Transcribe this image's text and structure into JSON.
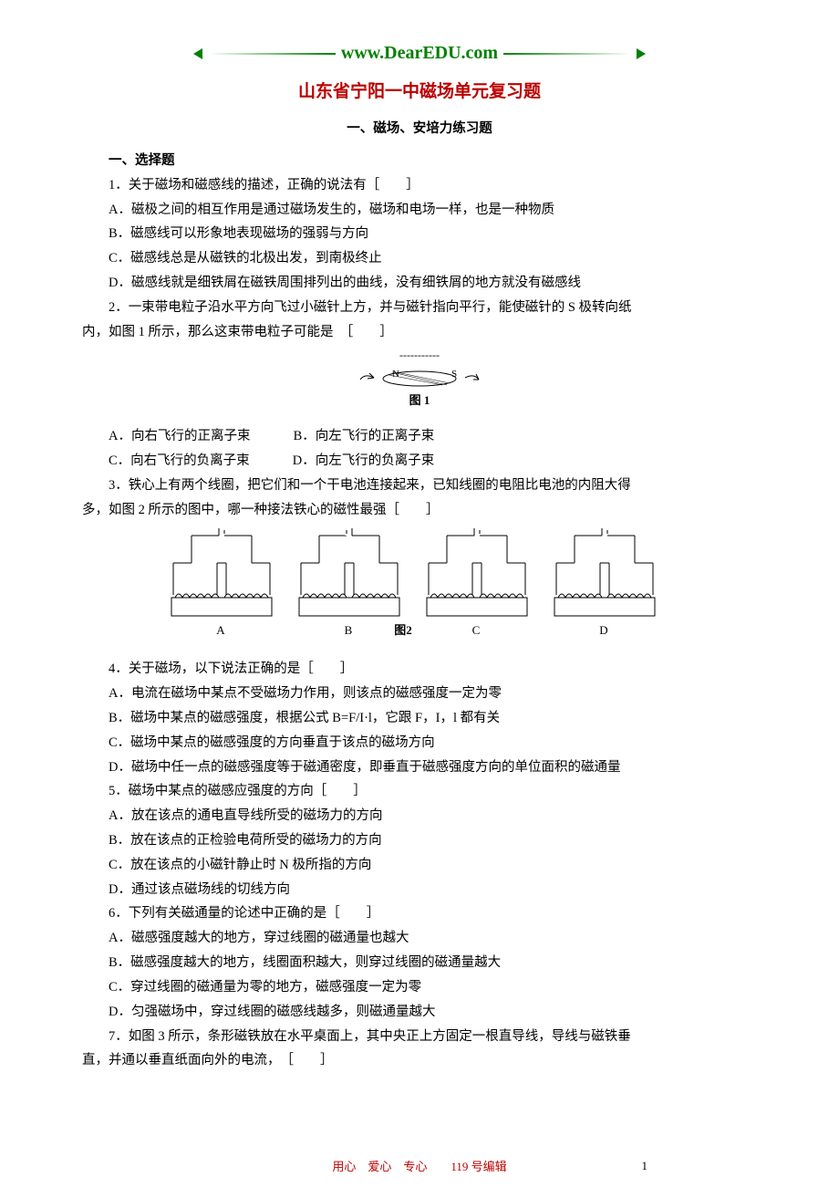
{
  "logo": {
    "url": "www.DearEDU.com"
  },
  "title": "山东省宁阳一中磁场单元复习题",
  "subtitle": "一、磁场、安培力练习题",
  "section1": "一、选择题",
  "q1": {
    "stem": "1．关于磁场和磁感线的描述，正确的说法有［　　］",
    "a": "A．磁极之间的相互作用是通过磁场发生的，磁场和电场一样，也是一种物质",
    "b": "B．磁感线可以形象地表现磁场的强弱与方向",
    "c": "C．磁感线总是从磁铁的北极出发，到南极终止",
    "d": "D．磁感线就是细铁屑在磁铁周围排列出的曲线，没有细铁屑的地方就没有磁感线"
  },
  "q2": {
    "stem_a": "2．一束带电粒子沿水平方向飞过小磁针上方，并与磁针指向平行，能使磁针的 S 极转向纸",
    "stem_b": "内，如图 1 所示，那么这束带电粒子可能是　［　　］",
    "fig": {
      "dashes": "-----------",
      "n": "N",
      "s": "S",
      "caption": "图 1"
    },
    "a": "A．向右飞行的正离子束",
    "b": "B．向左飞行的正离子束",
    "c": "C．向右飞行的负离子束",
    "d": "D．向左飞行的负离子束"
  },
  "q3": {
    "stem_a": "3．铁心上有两个线圈，把它们和一个干电池连接起来，已知线圈的电阻比电池的内阻大得",
    "stem_b": "多，如图 2 所示的图中，哪一种接法铁心的磁性最强［　　］",
    "labels": {
      "a": "A",
      "b": "B",
      "c": "C",
      "d": "D",
      "caption": "图2"
    }
  },
  "q4": {
    "stem": "4．关于磁场，以下说法正确的是［　　］",
    "a": "A．电流在磁场中某点不受磁场力作用，则该点的磁感强度一定为零",
    "b": "B．磁场中某点的磁感强度，根据公式 B=F/I·l，它跟 F，I，l 都有关",
    "c": "C．磁场中某点的磁感强度的方向垂直于该点的磁场方向",
    "d": "D．磁场中任一点的磁感强度等于磁通密度，即垂直于磁感强度方向的单位面积的磁通量"
  },
  "q5": {
    "stem": "5．磁场中某点的磁感应强度的方向［　　］",
    "a": "A．放在该点的通电直导线所受的磁场力的方向",
    "b": "B．放在该点的正检验电荷所受的磁场力的方向",
    "c": "C．放在该点的小磁针静止时 N 极所指的方向",
    "d": "D．通过该点磁场线的切线方向"
  },
  "q6": {
    "stem": "6．下列有关磁通量的论述中正确的是［　　］",
    "a": "A．磁感强度越大的地方，穿过线圈的磁通量也越大",
    "b": "B．磁感强度越大的地方，线圈面积越大，则穿过线圈的磁通量越大",
    "c": "C．穿过线圈的磁通量为零的地方，磁感强度一定为零",
    "d": "D．匀强磁场中，穿过线圈的磁感线越多，则磁通量越大"
  },
  "q7": {
    "stem_a": "7．如图 3 所示，条形磁铁放在水平桌面上，其中央正上方固定一根直导线，导线与磁铁垂",
    "stem_b": "直，并通以垂直纸面向外的电流，　［　　］"
  },
  "footer": {
    "motto": "用心　爱心　专心　　119 号编辑",
    "page": "1"
  }
}
